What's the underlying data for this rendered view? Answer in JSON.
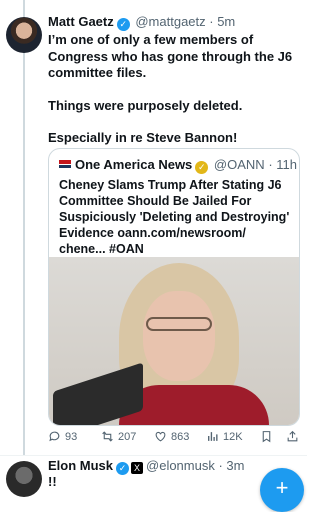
{
  "tweet": {
    "author_name": "Matt Gaetz",
    "author_handle": "@mattgaetz",
    "time": "· 5m",
    "paragraphs": [
      "I’m one of only a few members of Congress who has gone through the J6 committee files.",
      "Things were purposely deleted.",
      "Especially in re Steve Bannon!"
    ]
  },
  "quote": {
    "author_name": "One America News",
    "author_handle": "@OANN",
    "time": "· 11h",
    "text": "Cheney Slams Trump After Stating J6 Committee Should Be Jailed For Suspiciously 'Deleting and Destroying' Evidence oann.com/newsroom/ chene... #OAN"
  },
  "actions": {
    "replies": "93",
    "reposts": "207",
    "likes": "863",
    "views": "12K"
  },
  "next_tweet": {
    "author_name": "Elon Musk",
    "author_handle": "@elonmusk",
    "time": "· 3m",
    "text": "!!"
  },
  "compose_button": "+",
  "colors": {
    "accent": "#1d9bf0",
    "gold_badge": "#e2b719",
    "muted": "#536471"
  },
  "icons": [
    "verified-badge-icon",
    "gold-verified-badge-icon",
    "x-affiliate-icon",
    "reply-icon",
    "repost-icon",
    "like-icon",
    "views-icon",
    "bookmark-icon",
    "share-icon",
    "compose-icon"
  ]
}
